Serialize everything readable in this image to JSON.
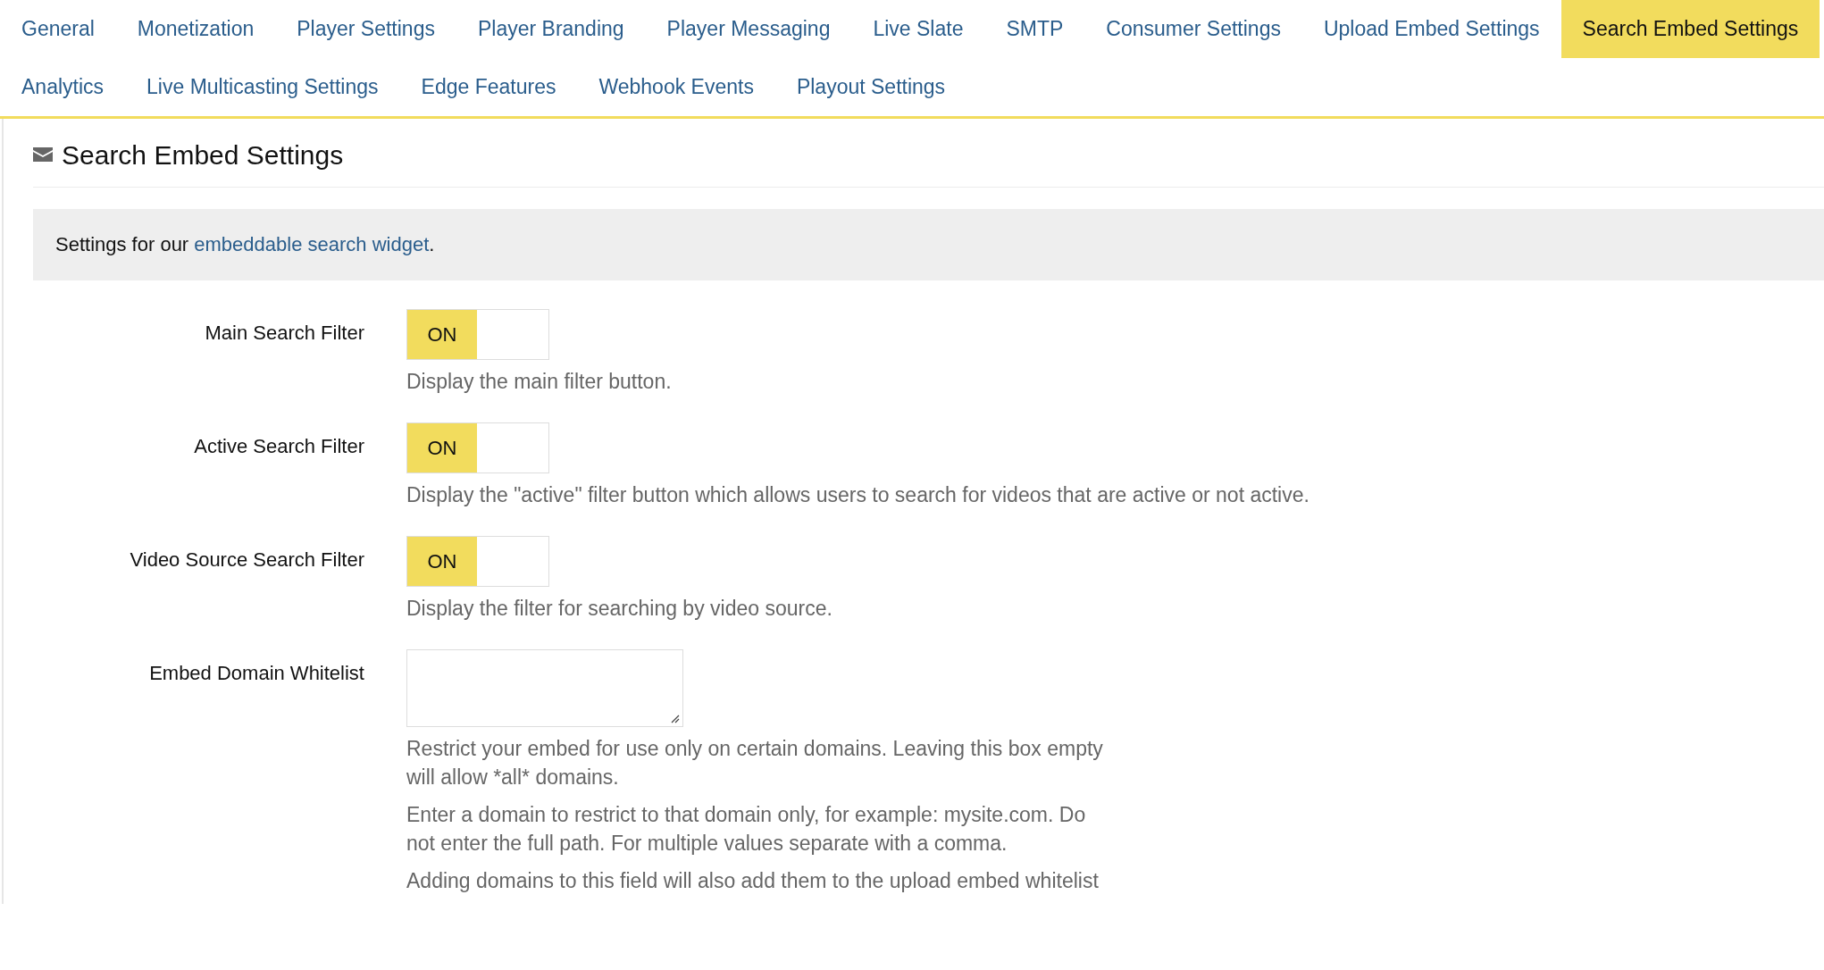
{
  "tab_rows": [
    [
      {
        "label": "General",
        "selected": false
      },
      {
        "label": "Monetization",
        "selected": false
      },
      {
        "label": "Player Settings",
        "selected": false
      },
      {
        "label": "Player Branding",
        "selected": false
      },
      {
        "label": "Player Messaging",
        "selected": false
      },
      {
        "label": "Live Slate",
        "selected": false
      },
      {
        "label": "SMTP",
        "selected": false
      },
      {
        "label": "Consumer Settings",
        "selected": false
      },
      {
        "label": "Upload Embed Settings",
        "selected": false
      },
      {
        "label": "Search Embed Settings",
        "selected": true
      }
    ],
    [
      {
        "label": "Analytics",
        "selected": false
      },
      {
        "label": "Live Multicasting Settings",
        "selected": false
      },
      {
        "label": "Edge Features",
        "selected": false
      },
      {
        "label": "Webhook Events",
        "selected": false
      },
      {
        "label": "Playout Settings",
        "selected": false
      }
    ]
  ],
  "section": {
    "title": "Search Embed Settings",
    "intro": {
      "before": "Settings for our ",
      "link": "embeddable search widget",
      "after": "."
    }
  },
  "settings": [
    {
      "kind": "toggle",
      "label": "Main Search Filter",
      "on": true,
      "state_label": "ON",
      "help": [
        "Display the main filter button."
      ]
    },
    {
      "kind": "toggle",
      "label": "Active Search Filter",
      "on": true,
      "state_label": "ON",
      "help": [
        "Display the \"active\" filter button which allows users to search for videos that are active or not active."
      ]
    },
    {
      "kind": "toggle",
      "label": "Video Source Search Filter",
      "on": true,
      "state_label": "ON",
      "help": [
        "Display the filter for searching by video source."
      ]
    },
    {
      "kind": "textarea",
      "label": "Embed Domain Whitelist",
      "help": [
        "Restrict your embed for use only on certain domains. Leaving this box empty will allow *all* domains.",
        "Enter a domain to restrict to that domain only, for example: mysite.com. Do not enter the full path. For multiple values separate with a comma.",
        "Adding domains to this field will also add them to the upload embed whitelist"
      ]
    }
  ]
}
